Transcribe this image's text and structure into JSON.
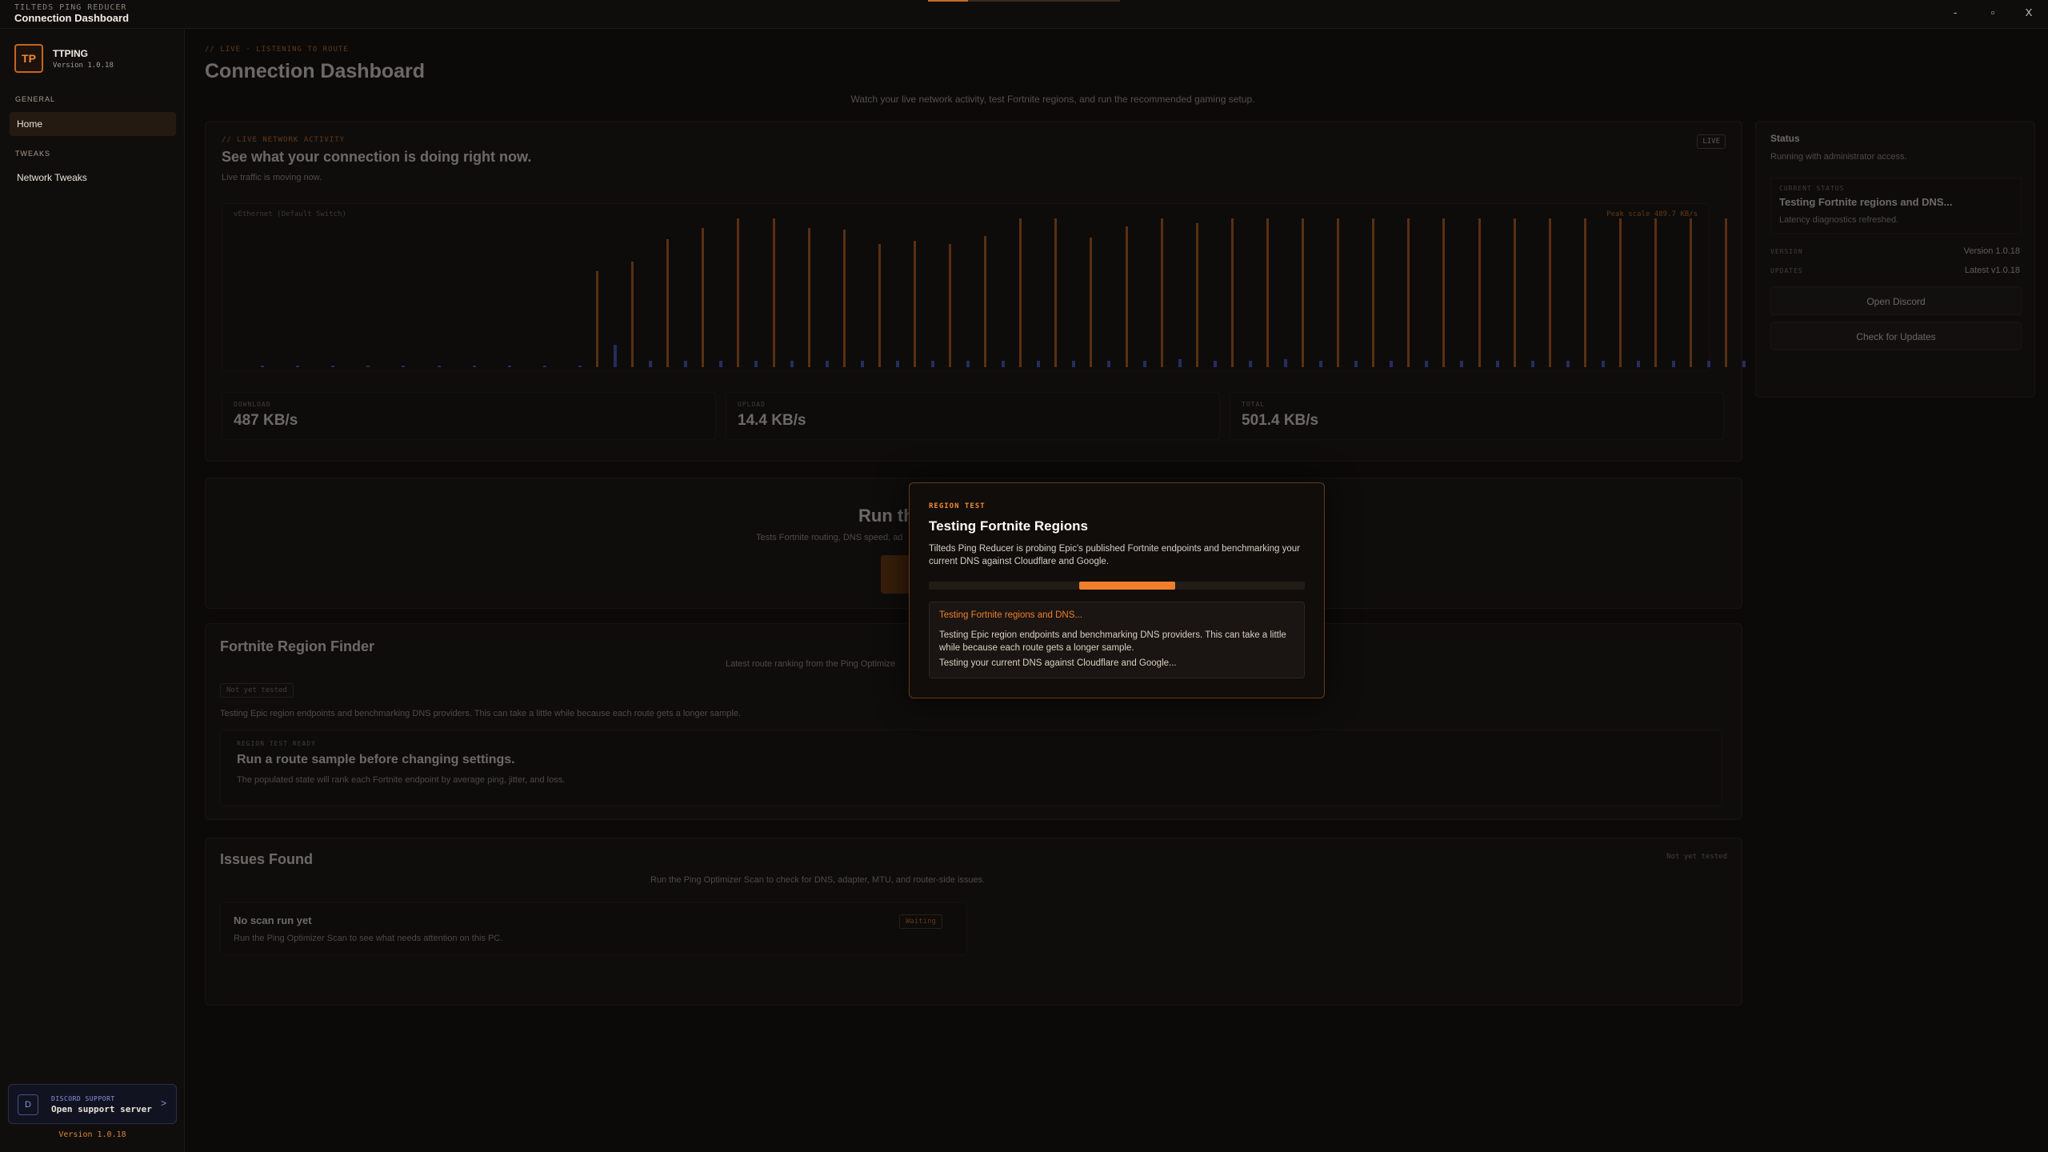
{
  "titlebar": {
    "app_caption": "TILTEDS PING REDUCER",
    "window_title": "Connection Dashboard",
    "minimize": "-",
    "maximize": "▫",
    "close": "X"
  },
  "sidebar": {
    "brand_name": "TTPING",
    "brand_version": "Version 1.0.18",
    "logo_text": "TP",
    "sections": [
      {
        "label": "GENERAL",
        "items": [
          {
            "label": "Home",
            "active": true
          }
        ]
      },
      {
        "label": "TWEAKS",
        "items": [
          {
            "label": "Network Tweaks",
            "active": false
          }
        ]
      }
    ],
    "discord": {
      "icon": "D",
      "label": "DISCORD SUPPORT",
      "text": "Open support server",
      "chevron": ">"
    },
    "footer_version": "Version 1.0.18"
  },
  "header": {
    "crumb": "// LIVE · LISTENING TO ROUTE",
    "title": "Connection Dashboard",
    "subtitle": "Watch your live network activity, test Fortnite regions, and run the recommended gaming setup."
  },
  "activity": {
    "kicker": "// LIVE NETWORK ACTIVITY",
    "title": "See what your connection is doing right now.",
    "subtitle": "Live traffic is moving now.",
    "badge": "LIVE",
    "adapter": "vEthernet (Default Switch)",
    "peak": "Peak scale 489.7 KB/s",
    "stats": [
      {
        "label": "DOWNLOAD",
        "value": "487 KB/s"
      },
      {
        "label": "UPLOAD",
        "value": "14.4 KB/s"
      },
      {
        "label": "TOTAL",
        "value": "501.4 KB/s"
      }
    ]
  },
  "chart_data": {
    "type": "bar",
    "peak_kbps": 489.7,
    "series": [
      {
        "name": "download",
        "color": "#c8641c",
        "values": [
          0,
          0,
          0,
          0,
          0,
          0,
          0,
          0,
          0,
          0,
          0.6,
          0.66,
          0.8,
          0.87,
          0.93,
          0.93,
          0.87,
          0.86,
          0.77,
          0.79,
          0.77,
          0.82,
          0.93,
          0.93,
          0.81,
          0.88,
          0.93,
          0.9,
          0.93,
          0.93,
          0.93,
          0.93,
          0.93,
          0.93,
          0.93,
          0.93,
          0.93,
          0.93,
          0.93,
          0.93,
          0.93,
          0.93,
          0.93,
          0.93,
          0.93,
          0.93,
          0.93,
          0.93,
          0.93,
          0.93
        ]
      },
      {
        "name": "upload",
        "color": "#4c5cd8",
        "values": [
          0.01,
          0.01,
          0.01,
          0.01,
          0.01,
          0.01,
          0.01,
          0.01,
          0.01,
          0.01,
          0.14,
          0.04,
          0.04,
          0.04,
          0.04,
          0.04,
          0.04,
          0.04,
          0.04,
          0.04,
          0.04,
          0.04,
          0.04,
          0.04,
          0.04,
          0.04,
          0.05,
          0.04,
          0.04,
          0.05,
          0.04,
          0.04,
          0.04,
          0.04,
          0.04,
          0.04,
          0.04,
          0.04,
          0.04,
          0.04,
          0.04,
          0.04,
          0.04,
          0.04,
          0.04,
          0.04,
          0.04,
          0.04,
          0.04,
          0.04
        ]
      }
    ]
  },
  "status": {
    "title": "Status",
    "subtitle": "Running with administrator access.",
    "current_label": "CURRENT STATUS",
    "current_value": "Testing Fortnite regions and DNS...",
    "current_note": "Latency diagnostics refreshed.",
    "version_label": "VERSION",
    "version_value": "Version 1.0.18",
    "updates_label": "UPDATES",
    "updates_value": "Latest v1.0.18",
    "discord_button": "Open Discord",
    "update_button": "Check for Updates"
  },
  "optimizer": {
    "title_partial": "Run th",
    "desc_partial": "Tests Fortnite routing, DNS speed, ad"
  },
  "region_finder": {
    "title": "Fortnite Region Finder",
    "subtitle": "Latest route ranking from the Ping Optimize",
    "pill": "Not yet tested",
    "note": "Testing Epic region endpoints and benchmarking DNS providers. This can take a little while because each route gets a longer sample.",
    "inner_kicker": "REGION TEST READY",
    "inner_title": "Run a route sample before changing settings.",
    "inner_desc": "The populated state will rank each Fortnite endpoint by average ping, jitter, and loss."
  },
  "issues": {
    "title": "Issues Found",
    "pill": "Not yet tested",
    "subtitle": "Run the Ping Optimizer Scan to check for DNS, adapter, MTU, and router-side issues.",
    "item_title": "No scan run yet",
    "item_desc": "Run the Ping Optimizer Scan to see what needs attention on this PC.",
    "item_badge": "Waiting"
  },
  "modal": {
    "kicker": "REGION TEST",
    "title": "Testing Fortnite Regions",
    "desc": "Tilteds Ping Reducer is probing Epic's published Fortnite endpoints and benchmarking your current DNS against Cloudflare and Google.",
    "progress_start": 0.4,
    "progress_end": 0.655,
    "log": [
      "Testing Fortnite regions and DNS...",
      "Testing Epic region endpoints and benchmarking DNS providers. This can take a little while because each route gets a longer sample.",
      "Testing your current DNS against Cloudflare and Google..."
    ]
  }
}
